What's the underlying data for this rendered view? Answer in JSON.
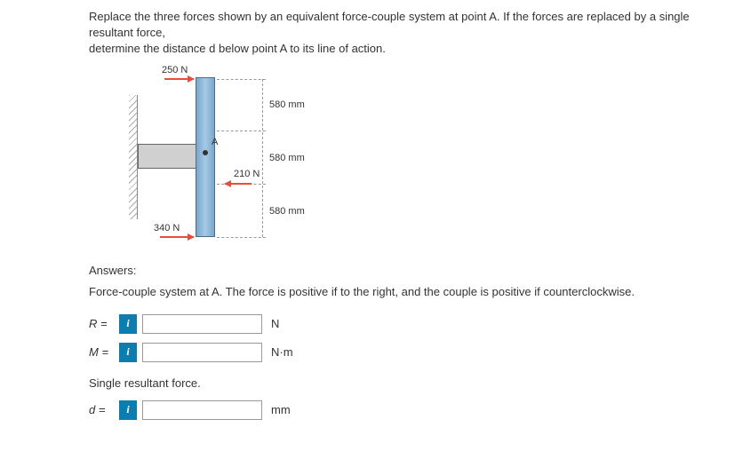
{
  "question": {
    "line1": "Replace the three forces shown by an equivalent force-couple system at point A. If the forces are replaced by a single resultant force,",
    "line2": "determine the distance d below point A to its line of action."
  },
  "figure": {
    "forces": {
      "f250": "250 N",
      "f210": "210 N",
      "f340": "340 N"
    },
    "pointLabel": "A",
    "dimensions": {
      "d1": "580 mm",
      "d2": "580 mm",
      "d3": "580 mm"
    }
  },
  "answers": {
    "heading": "Answers:",
    "instruction": "Force-couple system at A. The force is positive if to the right, and the couple is positive if counterclockwise.",
    "fields": {
      "R": {
        "label": "R =",
        "unit": "N",
        "value": ""
      },
      "M": {
        "label": "M =",
        "unit": "N·m",
        "value": ""
      },
      "d": {
        "label": "d =",
        "unit": "mm",
        "value": ""
      }
    },
    "subheading": "Single resultant force."
  },
  "icons": {
    "info": "i"
  }
}
